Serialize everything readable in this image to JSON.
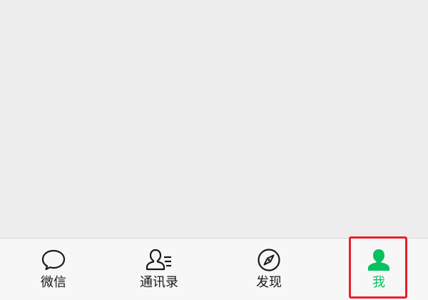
{
  "tabbar": {
    "tabs": [
      {
        "label": "微信",
        "icon": "chat-bubble-icon",
        "active": false
      },
      {
        "label": "通讯录",
        "icon": "contacts-icon",
        "active": false
      },
      {
        "label": "发现",
        "icon": "compass-icon",
        "active": false
      },
      {
        "label": "我",
        "icon": "person-icon",
        "active": true
      }
    ]
  },
  "colors": {
    "background": "#ededed",
    "tabbar_background": "#f7f7f7",
    "active": "#07c160",
    "inactive": "#191919",
    "highlight_box": "#e8202a"
  }
}
